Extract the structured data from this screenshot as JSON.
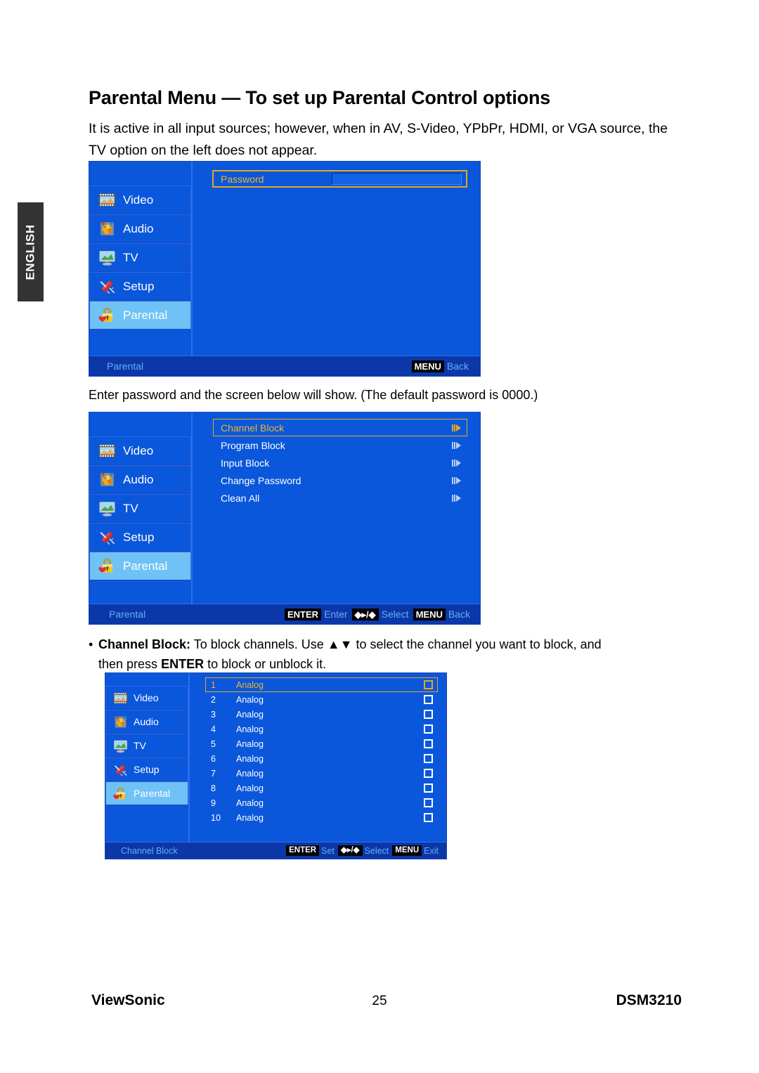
{
  "side_tab": {
    "label": "ENGLISH"
  },
  "page": {
    "title": "Parental Menu — To set up Parental Control options",
    "intro": "It is active in all input sources; however, when in AV, S-Video, YPbPr, HDMI, or VGA source, the TV option on the left does not appear.",
    "mid_note": "Enter password and the screen below will show. (The default password is 0000.)",
    "bullet": {
      "bullet_char": "•",
      "term": "Channel Block:",
      "line1_rest": " To block channels. Use ▲▼ to select the channel you want to block, and",
      "line2_pre": "then press ",
      "line2_key": "ENTER",
      "line2_post": " to block or unblock it."
    }
  },
  "footer": {
    "brand_part1": "View",
    "brand_part2": "Sonic",
    "page_number": "25",
    "model": "DSM3210"
  },
  "colors": {
    "osd_bg": "#0a57dc",
    "osd_statusbar": "#0b37a8",
    "highlight_row": "#6fc2f5",
    "accent_amber": "#e8a61d",
    "hint_text": "#63b0f7",
    "side_tab_bg": "#333333"
  },
  "nav": {
    "items": [
      {
        "label": "Video",
        "icon": "film-strip-icon",
        "selected": false
      },
      {
        "label": "Audio",
        "icon": "speaker-icon",
        "selected": false
      },
      {
        "label": "TV",
        "icon": "tv-monitor-icon",
        "selected": false
      },
      {
        "label": "Setup",
        "icon": "toolknife-icon",
        "selected": false
      },
      {
        "label": "Parental",
        "icon": "padlock-heart-icon",
        "selected": true
      }
    ]
  },
  "panel1": {
    "caption": "Parental",
    "password_field": {
      "label": "Password",
      "value": "",
      "placeholder": ""
    },
    "hints": [
      {
        "key": "MENU",
        "action": "Back"
      }
    ]
  },
  "panel2": {
    "caption": "Parental",
    "rows": [
      {
        "label": "Channel Block",
        "indicator": "submenu-arrow-icon",
        "selected": true
      },
      {
        "label": "Program Block",
        "indicator": "submenu-arrow-icon",
        "selected": false
      },
      {
        "label": "Input Block",
        "indicator": "submenu-arrow-icon",
        "selected": false
      },
      {
        "label": "Change Password",
        "indicator": "submenu-arrow-icon",
        "selected": false
      },
      {
        "label": "Clean All",
        "indicator": "submenu-arrow-icon",
        "selected": false
      }
    ],
    "hints": [
      {
        "key": "ENTER",
        "action": "Enter"
      },
      {
        "key": "◆▸/◆",
        "action": "Select"
      },
      {
        "key": "MENU",
        "action": "Back"
      }
    ]
  },
  "panel3": {
    "caption": "Channel Block",
    "channels": [
      {
        "number": "1",
        "name": "Analog",
        "blocked": false,
        "selected": true
      },
      {
        "number": "2",
        "name": "Analog",
        "blocked": false,
        "selected": false
      },
      {
        "number": "3",
        "name": "Analog",
        "blocked": false,
        "selected": false
      },
      {
        "number": "4",
        "name": "Analog",
        "blocked": false,
        "selected": false
      },
      {
        "number": "5",
        "name": "Analog",
        "blocked": false,
        "selected": false
      },
      {
        "number": "6",
        "name": "Analog",
        "blocked": false,
        "selected": false
      },
      {
        "number": "7",
        "name": "Analog",
        "blocked": false,
        "selected": false
      },
      {
        "number": "8",
        "name": "Analog",
        "blocked": false,
        "selected": false
      },
      {
        "number": "9",
        "name": "Analog",
        "blocked": false,
        "selected": false
      },
      {
        "number": "10",
        "name": "Analog",
        "blocked": false,
        "selected": false
      }
    ],
    "hints": [
      {
        "key": "ENTER",
        "action": "Set"
      },
      {
        "key": "◆▸/◆",
        "action": "Select"
      },
      {
        "key": "MENU",
        "action": "Exit"
      }
    ]
  }
}
